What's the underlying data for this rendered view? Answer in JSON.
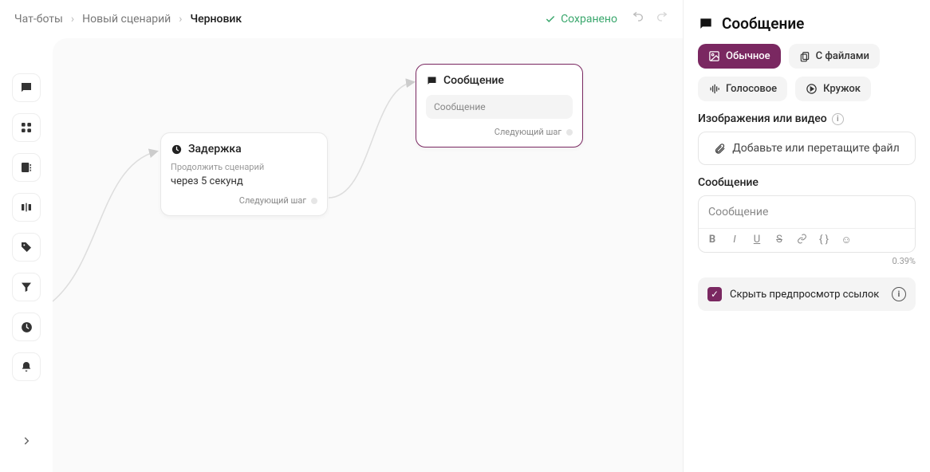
{
  "breadcrumbs": {
    "level1": "Чат-боты",
    "level2": "Новый сценарий",
    "current": "Черновик"
  },
  "topbar": {
    "savedLabel": "Сохранено"
  },
  "canvas": {
    "delayNode": {
      "title": "Задержка",
      "subtitle": "Продолжить сценарий",
      "detail": "через 5 секунд",
      "nextStep": "Следующий шаг"
    },
    "messageNode": {
      "title": "Сообщение",
      "preview": "Сообщение",
      "nextStep": "Следующий шаг"
    }
  },
  "panel": {
    "title": "Сообщение",
    "pills": {
      "normal": "Обычное",
      "withFiles": "С файлами",
      "voice": "Голосовое",
      "circle": "Кружок"
    },
    "media": {
      "label": "Изображения или видео",
      "uploadText": "Добавьте или перетащите файл"
    },
    "message": {
      "label": "Сообщение",
      "placeholder": "Сообщение",
      "percent": "0.39%"
    },
    "hidePreview": {
      "label": "Скрыть предпросмотр ссылок"
    }
  }
}
